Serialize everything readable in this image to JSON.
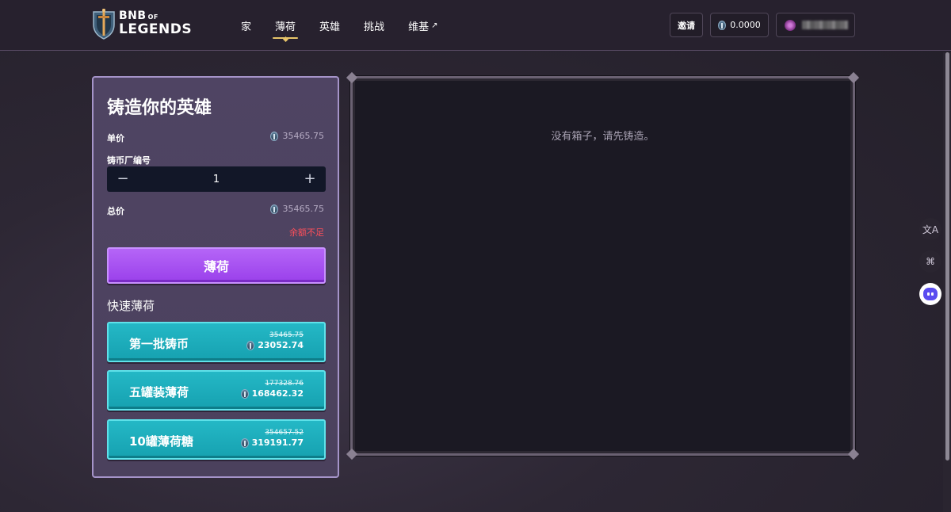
{
  "brand": {
    "logo_top": "BNB",
    "logo_of": "OF",
    "logo_bottom": "LEGENDS",
    "accent_color": "#e8c56a"
  },
  "nav": {
    "items": [
      {
        "label": "家",
        "active": false
      },
      {
        "label": "薄荷",
        "active": true
      },
      {
        "label": "英雄",
        "active": false
      },
      {
        "label": "挑战",
        "active": false
      },
      {
        "label": "维基",
        "active": false,
        "external_icon": "external-link-icon"
      }
    ]
  },
  "header": {
    "invite_label": "邀请",
    "balance": "0.0000",
    "wallet_address_blurred": true
  },
  "mint": {
    "title": "铸造你的英雄",
    "unit_price_label": "单价",
    "unit_price": "35465.75",
    "minter_id_label": "铸币厂编号",
    "quantity": "1",
    "decrement_symbol": "−",
    "increment_symbol": "+",
    "total_label": "总价",
    "total_price": "35465.75",
    "insufficient_balance": "余额不足",
    "mint_button": "薄荷",
    "mint_color": "#a24cf0"
  },
  "quick_mint": {
    "title": "快速薄荷",
    "color": "#1db0bf",
    "options": [
      {
        "label": "第一批铸币",
        "old_price": "35465.75",
        "new_price": "23052.74"
      },
      {
        "label": "五罐装薄荷",
        "old_price": "177328.76",
        "new_price": "168462.32"
      },
      {
        "label": "10罐薄荷糖",
        "old_price": "354657.52",
        "new_price": "319191.77"
      }
    ]
  },
  "boxes": {
    "empty_message": "没有箱子，请先铸造。"
  },
  "side_tools": [
    {
      "icon": "translate-icon",
      "glyph": "文A"
    },
    {
      "icon": "apps-icon",
      "glyph": "⌘"
    },
    {
      "icon": "assistant-bot-icon",
      "glyph": ""
    }
  ]
}
